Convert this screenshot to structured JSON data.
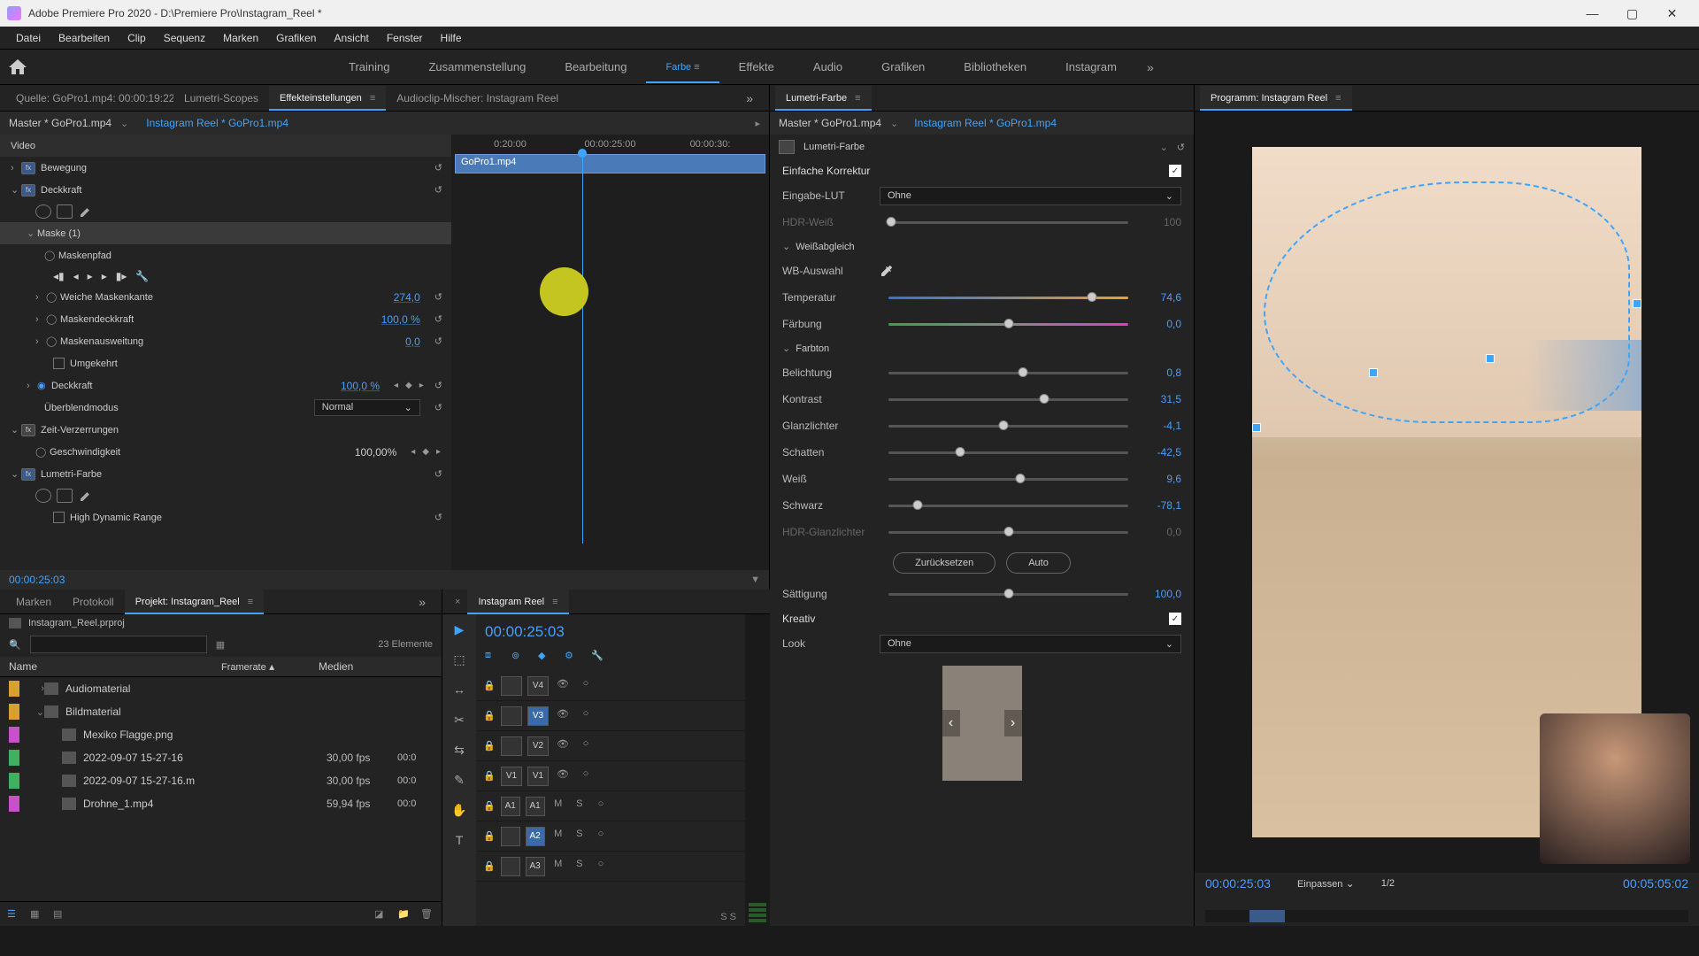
{
  "window": {
    "title": "Adobe Premiere Pro 2020 - D:\\Premiere Pro\\Instagram_Reel *"
  },
  "menu": [
    "Datei",
    "Bearbeiten",
    "Clip",
    "Sequenz",
    "Marken",
    "Grafiken",
    "Ansicht",
    "Fenster",
    "Hilfe"
  ],
  "workspaces": {
    "items": [
      "Training",
      "Zusammenstellung",
      "Bearbeitung",
      "Farbe",
      "Effekte",
      "Audio",
      "Grafiken",
      "Bibliotheken",
      "Instagram"
    ],
    "active": "Farbe"
  },
  "ec": {
    "tabs": {
      "source": "Quelle: GoPro1.mp4: 00:00:19:22",
      "scopes": "Lumetri-Scopes",
      "effects": "Effekteinstellungen",
      "mixer": "Audioclip-Mischer: Instagram Reel"
    },
    "master": "Master * GoPro1.mp4",
    "clip": "Instagram Reel * GoPro1.mp4",
    "times": {
      "t1": "0:20:00",
      "t2": "00:00:25:00",
      "t3": "00:00:30:"
    },
    "clipname": "GoPro1.mp4",
    "video_label": "Video",
    "motion": "Bewegung",
    "opacity": "Deckkraft",
    "mask": "Maske (1)",
    "maskpath": "Maskenpfad",
    "feather": {
      "label": "Weiche Maskenkante",
      "value": "274,0"
    },
    "maskopacity": {
      "label": "Maskendeckkraft",
      "value": "100,0 %"
    },
    "expansion": {
      "label": "Maskenausweitung",
      "value": "0,0"
    },
    "inverted": "Umgekehrt",
    "opacity2": {
      "label": "Deckkraft",
      "value": "100,0 %"
    },
    "blend": {
      "label": "Überblendmodus",
      "value": "Normal"
    },
    "timeremap": "Zeit-Verzerrungen",
    "speed": {
      "label": "Geschwindigkeit",
      "value": "100,00%"
    },
    "lumetri": "Lumetri-Farbe",
    "hdr": "High Dynamic Range",
    "timecode": "00:00:25:03"
  },
  "lumetri": {
    "panel_title": "Lumetri-Farbe",
    "master": "Master * GoPro1.mp4",
    "clip": "Instagram Reel * GoPro1.mp4",
    "fx_name": "Lumetri-Farbe",
    "basic": "Einfache Korrektur",
    "input_lut": {
      "label": "Eingabe-LUT",
      "value": "Ohne"
    },
    "hdr_white": {
      "label": "HDR-Weiß",
      "value": "100"
    },
    "whitebalance": "Weißabgleich",
    "wb_select": "WB-Auswahl",
    "temperature": {
      "label": "Temperatur",
      "value": "74,6",
      "pos": 85
    },
    "tint": {
      "label": "Färbung",
      "value": "0,0",
      "pos": 50
    },
    "tone": "Farbton",
    "exposure": {
      "label": "Belichtung",
      "value": "0,8",
      "pos": 56
    },
    "contrast": {
      "label": "Kontrast",
      "value": "31,5",
      "pos": 65
    },
    "highlights": {
      "label": "Glanzlichter",
      "value": "-4,1",
      "pos": 48
    },
    "shadows": {
      "label": "Schatten",
      "value": "-42,5",
      "pos": 30
    },
    "whites": {
      "label": "Weiß",
      "value": "9,6",
      "pos": 55
    },
    "blacks": {
      "label": "Schwarz",
      "value": "-78,1",
      "pos": 12
    },
    "hdr_spec": {
      "label": "HDR-Glanzlichter",
      "value": "0,0",
      "pos": 50
    },
    "reset_btn": "Zurücksetzen",
    "auto_btn": "Auto",
    "saturation": {
      "label": "Sättigung",
      "value": "100,0",
      "pos": 50
    },
    "creative": "Kreativ",
    "look": {
      "label": "Look",
      "value": "Ohne"
    }
  },
  "program": {
    "title": "Programm: Instagram Reel",
    "timecode": "00:00:25:03",
    "fit": "Einpassen",
    "zoom": "1/2",
    "duration": "00:05:05:02"
  },
  "project": {
    "tabs": {
      "marken": "Marken",
      "protokoll": "Protokoll",
      "projekt": "Projekt: Instagram_Reel"
    },
    "filename": "Instagram_Reel.prproj",
    "count": "23 Elemente",
    "headers": {
      "name": "Name",
      "framerate": "Framerate",
      "media": "Medien"
    },
    "items": [
      {
        "color": "#d8a030",
        "name": "Audiomaterial",
        "fr": "",
        "folder": true
      },
      {
        "color": "#d8a030",
        "name": "Bildmaterial",
        "fr": "",
        "folder": true,
        "open": true
      },
      {
        "color": "#c850c8",
        "name": "Mexiko Flagge.png",
        "fr": ""
      },
      {
        "color": "#40b060",
        "name": "2022-09-07 15-27-16",
        "fr": "30,00 fps",
        "media": "00:0"
      },
      {
        "color": "#40b060",
        "name": "2022-09-07 15-27-16.m",
        "fr": "30,00 fps",
        "media": "00:0"
      },
      {
        "color": "#c850c8",
        "name": "Drohne_1.mp4",
        "fr": "59,94 fps",
        "media": "00:0"
      }
    ]
  },
  "timeline": {
    "title": "Instagram Reel",
    "timecode": "00:00:25:03",
    "tracks": [
      {
        "src": "",
        "tgt": "V4",
        "type": "v"
      },
      {
        "src": "",
        "tgt": "V3",
        "type": "v",
        "active": true
      },
      {
        "src": "",
        "tgt": "V2",
        "type": "v"
      },
      {
        "src": "V1",
        "tgt": "V1",
        "type": "v"
      },
      {
        "src": "A1",
        "tgt": "A1",
        "type": "a"
      },
      {
        "src": "",
        "tgt": "A2",
        "type": "a",
        "active": true
      },
      {
        "src": "",
        "tgt": "A3",
        "type": "a"
      }
    ],
    "ss": "S S"
  }
}
